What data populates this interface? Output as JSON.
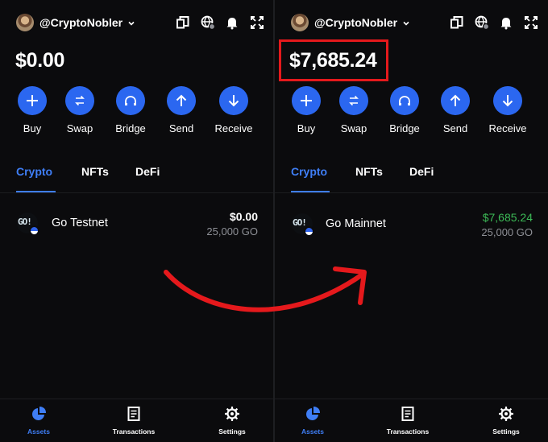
{
  "colors": {
    "accent": "#2b67f0",
    "tab_active": "#3f7ef5",
    "positive": "#3cba56",
    "highlight": "#e5191c",
    "arrow": "#e5191c"
  },
  "left": {
    "username": "@CryptoNobler",
    "balance": "$0.00",
    "actions": [
      {
        "label": "Buy",
        "icon": "plus-icon"
      },
      {
        "label": "Swap",
        "icon": "swap-icon"
      },
      {
        "label": "Bridge",
        "icon": "bridge-icon"
      },
      {
        "label": "Send",
        "icon": "arrow-up-icon"
      },
      {
        "label": "Receive",
        "icon": "arrow-down-icon"
      }
    ],
    "tabs": [
      "Crypto",
      "NFTs",
      "DeFi"
    ],
    "active_tab": "Crypto",
    "asset": {
      "logo_text": "GO!",
      "name": "Go Testnet",
      "value": "$0.00",
      "amount": "25,000 GO"
    },
    "nav": [
      {
        "label": "Assets",
        "icon": "pie-chart-icon",
        "active": true
      },
      {
        "label": "Transactions",
        "icon": "receipt-icon",
        "active": false
      },
      {
        "label": "Settings",
        "icon": "gear-icon",
        "active": false
      }
    ]
  },
  "right": {
    "username": "@CryptoNobler",
    "balance": "$7,685.24",
    "actions": [
      {
        "label": "Buy",
        "icon": "plus-icon"
      },
      {
        "label": "Swap",
        "icon": "swap-icon"
      },
      {
        "label": "Bridge",
        "icon": "bridge-icon"
      },
      {
        "label": "Send",
        "icon": "arrow-up-icon"
      },
      {
        "label": "Receive",
        "icon": "arrow-down-icon"
      }
    ],
    "tabs": [
      "Crypto",
      "NFTs",
      "DeFi"
    ],
    "active_tab": "Crypto",
    "asset": {
      "logo_text": "GO!",
      "name": "Go Mainnet",
      "value": "$7,685.24",
      "amount": "25,000 GO"
    },
    "nav": [
      {
        "label": "Assets",
        "icon": "pie-chart-icon",
        "active": true
      },
      {
        "label": "Transactions",
        "icon": "receipt-icon",
        "active": false
      },
      {
        "label": "Settings",
        "icon": "gear-icon",
        "active": false
      }
    ]
  }
}
